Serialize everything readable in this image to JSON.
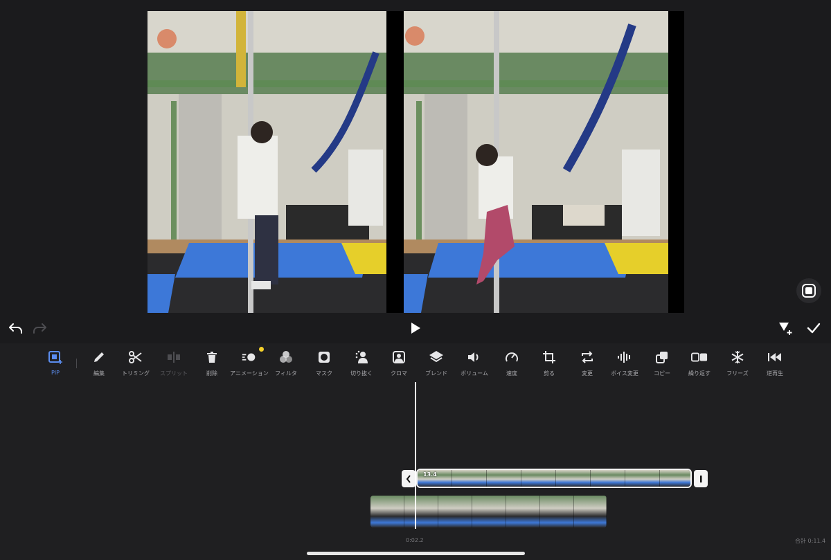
{
  "toolbar": {
    "tools": [
      {
        "id": "pip",
        "label": "PIP",
        "icon": "pip-icon",
        "state": "active"
      },
      {
        "id": "edit",
        "label": "編集",
        "icon": "pencil-icon",
        "state": "normal"
      },
      {
        "id": "trim",
        "label": "トリミング",
        "icon": "scissors-icon",
        "state": "normal"
      },
      {
        "id": "split",
        "label": "スプリット",
        "icon": "split-icon",
        "state": "disabled"
      },
      {
        "id": "delete",
        "label": "削除",
        "icon": "trash-icon",
        "state": "normal"
      },
      {
        "id": "animation",
        "label": "アニメーション",
        "icon": "animation-icon",
        "state": "normal",
        "badge": true
      },
      {
        "id": "filter",
        "label": "フィルタ",
        "icon": "filter-icon",
        "state": "normal"
      },
      {
        "id": "mask",
        "label": "マスク",
        "icon": "mask-icon",
        "state": "normal"
      },
      {
        "id": "cutout",
        "label": "切り抜く",
        "icon": "cutout-icon",
        "state": "normal"
      },
      {
        "id": "chroma",
        "label": "クロマ",
        "icon": "chroma-icon",
        "state": "normal"
      },
      {
        "id": "blend",
        "label": "ブレンド",
        "icon": "layers-icon",
        "state": "normal"
      },
      {
        "id": "volume",
        "label": "ボリューム",
        "icon": "speaker-icon",
        "state": "normal"
      },
      {
        "id": "speed",
        "label": "速度",
        "icon": "speedometer-icon",
        "state": "normal"
      },
      {
        "id": "crop",
        "label": "剪る",
        "icon": "crop-icon",
        "state": "normal"
      },
      {
        "id": "replace",
        "label": "変更",
        "icon": "replace-icon",
        "state": "normal"
      },
      {
        "id": "voice",
        "label": "ボイス変更",
        "icon": "waveform-icon",
        "state": "normal"
      },
      {
        "id": "copy",
        "label": "コピー",
        "icon": "copy-icon",
        "state": "normal"
      },
      {
        "id": "repeat",
        "label": "繰り返す",
        "icon": "repeat-icon",
        "state": "normal"
      },
      {
        "id": "freeze",
        "label": "フリーズ",
        "icon": "snowflake-icon",
        "state": "normal"
      },
      {
        "id": "reverse",
        "label": "逆再生",
        "icon": "rewind-icon",
        "state": "normal"
      }
    ]
  },
  "timeline": {
    "clip_label": "13.4",
    "current_time": "0:02.2",
    "total_time": "合計 0:11.4"
  },
  "colors": {
    "background": "#1f1f21",
    "accent": "#5b8def",
    "badge": "#f5d02a"
  }
}
